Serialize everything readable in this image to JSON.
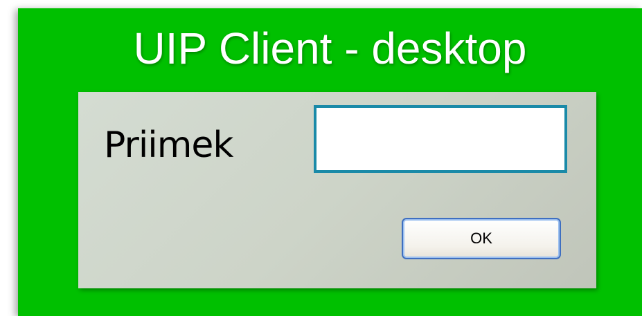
{
  "window": {
    "title": "UIP Client - desktop",
    "background_color": "#00c000"
  },
  "dialog": {
    "field_label": "Priimek",
    "field_value": "",
    "field_border_color": "#1a8aa8",
    "ok_label": "OK"
  }
}
